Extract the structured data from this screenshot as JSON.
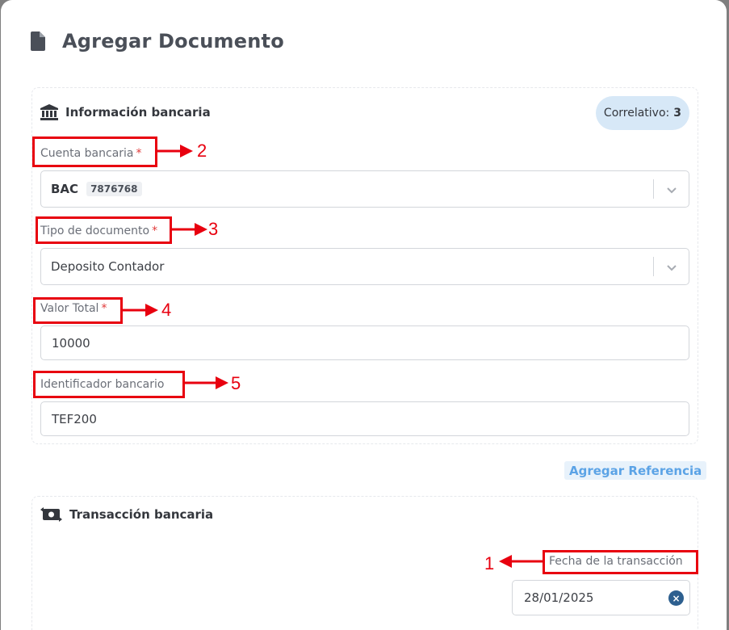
{
  "modal": {
    "title": "Agregar Documento",
    "icons": {
      "title": "file-icon",
      "bank_section": "bank-icon",
      "transaction_section": "money-transfer-icon"
    }
  },
  "bank_info": {
    "heading": "Información bancaria",
    "correlativo_label": "Correlativo:",
    "correlativo_value": "3",
    "cuenta": {
      "label": "Cuenta bancaria",
      "required_mark": "*",
      "bank": "BAC",
      "account": "7876768"
    },
    "tipo": {
      "label": "Tipo de documento",
      "required_mark": "*",
      "value": "Deposito Contador"
    },
    "valor": {
      "label": "Valor Total",
      "required_mark": "*",
      "value": "10000"
    },
    "identificador": {
      "label": "Identificador bancario",
      "value": "TEF200"
    }
  },
  "add_reference_label": "Agregar Referencia",
  "transaction": {
    "heading": "Transacción bancaria",
    "fecha_label": "Fecha de la transacción",
    "fecha_value": "28/01/2025",
    "clear_symbol": "×"
  },
  "annotations": [
    "1",
    "2",
    "3",
    "4",
    "5"
  ],
  "colors": {
    "annotation": "#e8000f",
    "accent": "#5ba3e6",
    "badge_bg": "#d7e8f7"
  }
}
